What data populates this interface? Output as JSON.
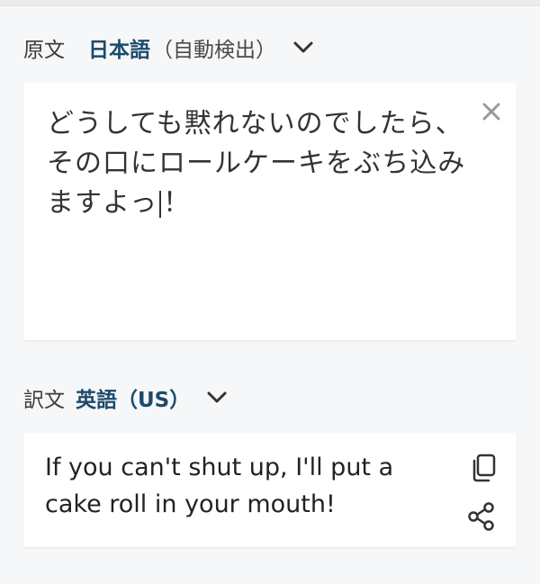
{
  "source": {
    "label": "原文",
    "language": "日本語",
    "detect_note": "（自動検出）",
    "text_before_caret": "どうしても黙れないのでしたら、その口にロールケーキをぶち込みますよっ",
    "text_after_caret": "！",
    "icons": {
      "dropdown": "chevron-down-icon",
      "clear": "close-icon"
    }
  },
  "target": {
    "label": "訳文",
    "language": "英語（US）",
    "text": "If you can't shut up, I'll put a cake roll in your mouth!",
    "icons": {
      "dropdown": "chevron-down-icon",
      "copy": "copy-icon",
      "share": "share-icon"
    }
  },
  "colors": {
    "accent": "#1b4a6b",
    "background": "#f6f7f8",
    "card": "#ffffff"
  }
}
